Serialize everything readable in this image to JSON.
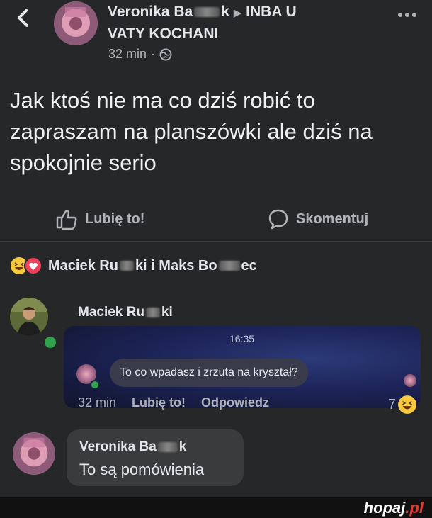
{
  "header": {
    "author": "Veronika Ba",
    "author_blur_tail": "k",
    "arrow": "▶",
    "group": "INBA U",
    "group_line2": "VATY KOCHANI",
    "time": "32 min",
    "sep": "·"
  },
  "post": {
    "text": "Jak ktoś nie ma co dziś robić to zapraszam na planszówki ale dziś na spokojnie serio"
  },
  "actions": {
    "like": "Lubię to!",
    "comment": "Skomentuj"
  },
  "reactions": {
    "names_part1": "Maciek Ru",
    "names_part2": "ki i Maks Bo",
    "names_part3": "ec"
  },
  "comment1": {
    "author_part1": "Maciek Ru",
    "author_part2": "ki",
    "time": "16:35",
    "message": "To co wpadasz i zrzuta na kryształ?",
    "age": "32 min",
    "like": "Lubię to!",
    "reply": "Odpowiedz",
    "reaction_count": "7"
  },
  "comment2": {
    "author_part1": "Veronika Ba",
    "author_part2": "k",
    "text": "To są pomówienia"
  },
  "footer": {
    "logo_main": "hopaj",
    "logo_tld": ".pl"
  },
  "colors": {
    "background": "#262729",
    "text": "#e4e6eb",
    "muted": "#b0b3b8",
    "online": "#31a24c",
    "logo_accent": "#e03a2f"
  }
}
